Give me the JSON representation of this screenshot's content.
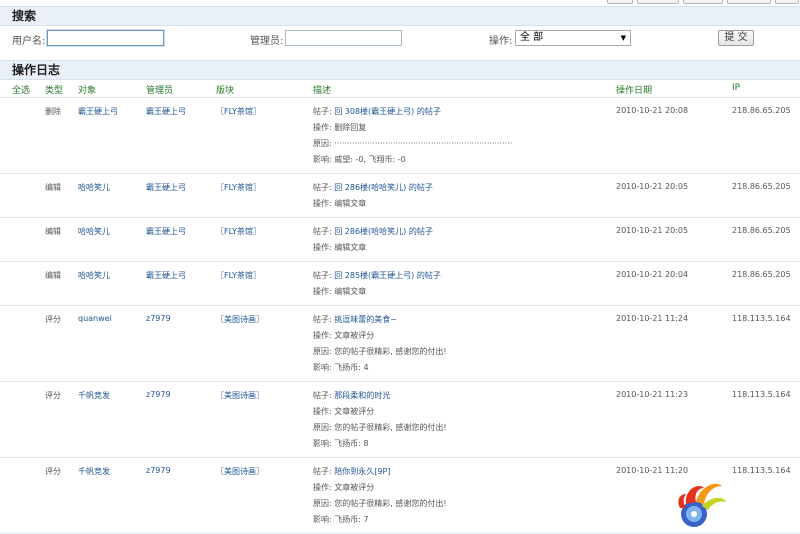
{
  "search": {
    "title": "搜索",
    "username_label": "用户名:",
    "username_value": "",
    "admin_label": "管理员:",
    "admin_value": "",
    "action_label": "操作:",
    "action_selected": "全 部",
    "submit_label": "提 交"
  },
  "log": {
    "title": "操作日志",
    "columns": {
      "select_all": "全选",
      "type": "类型",
      "target": "对象",
      "admin": "管理员",
      "board": "版块",
      "desc": "描述",
      "date": "操作日期",
      "ip": "IP"
    },
    "rows": [
      {
        "type": "删除",
        "target": "霸王硬上弓",
        "admin": "霸王硬上弓",
        "board": "〖FLY茶馆〗",
        "desc_post_prefix": "帖子: ",
        "desc_post": "回 308楼(霸王硬上弓) 的帖子",
        "desc_lines": [
          "操作: 删除回复",
          "原因: ······································································",
          "影响: 威望: -0, 飞翔币: -0"
        ],
        "date": "2010-10-21 20:08",
        "ip": "218.86.65.205"
      },
      {
        "type": "编辑",
        "target": "哈哈笑儿",
        "admin": "霸王硬上弓",
        "board": "〖FLY茶馆〗",
        "desc_post_prefix": "帖子: ",
        "desc_post": "回 286楼(哈哈笑儿) 的帖子",
        "desc_lines": [
          "操作: 编辑文章"
        ],
        "date": "2010-10-21 20:05",
        "ip": "218.86.65.205"
      },
      {
        "type": "编辑",
        "target": "哈哈笑儿",
        "admin": "霸王硬上弓",
        "board": "〖FLY茶馆〗",
        "desc_post_prefix": "帖子: ",
        "desc_post": "回 286楼(哈哈笑儿) 的帖子",
        "desc_lines": [
          "操作: 编辑文章"
        ],
        "date": "2010-10-21 20:05",
        "ip": "218.86.65.205"
      },
      {
        "type": "编辑",
        "target": "哈哈笑儿",
        "admin": "霸王硬上弓",
        "board": "〖FLY茶馆〗",
        "desc_post_prefix": "帖子: ",
        "desc_post": "回 285楼(霸王硬上弓) 的帖子",
        "desc_lines": [
          "操作: 编辑文章"
        ],
        "date": "2010-10-21 20:04",
        "ip": "218.86.65.205"
      },
      {
        "type": "评分",
        "target": "quanwei",
        "admin": "z7979",
        "board": "〖美图诗画〗",
        "desc_post_prefix": "帖子: ",
        "desc_post": "挑逗味蕾的美食~",
        "desc_lines": [
          "操作: 文章被评分",
          "原因: 您的帖子很精彩, 感谢您的付出!",
          "影响: 飞扬币: 4"
        ],
        "date": "2010-10-21 11:24",
        "ip": "118.113.5.164"
      },
      {
        "type": "评分",
        "target": "千帆竞发",
        "admin": "z7979",
        "board": "〖美图诗画〗",
        "desc_post_prefix": "帖子: ",
        "desc_post": "那段柔和的时光",
        "desc_lines": [
          "操作: 文章被评分",
          "原因: 您的帖子很精彩, 感谢您的付出!",
          "影响: 飞扬币: 8"
        ],
        "date": "2010-10-21 11:23",
        "ip": "118.113.5.164"
      },
      {
        "type": "评分",
        "target": "千帆竞发",
        "admin": "z7979",
        "board": "〖美图诗画〗",
        "desc_post_prefix": "帖子: ",
        "desc_post": "陪你到永久[9P]",
        "desc_lines": [
          "操作: 文章被评分",
          "原因: 您的帖子很精彩, 感谢您的付出!",
          "影响: 飞扬币: 7"
        ],
        "date": "2010-10-21 11:20",
        "ip": "118.113.5.164"
      }
    ]
  }
}
